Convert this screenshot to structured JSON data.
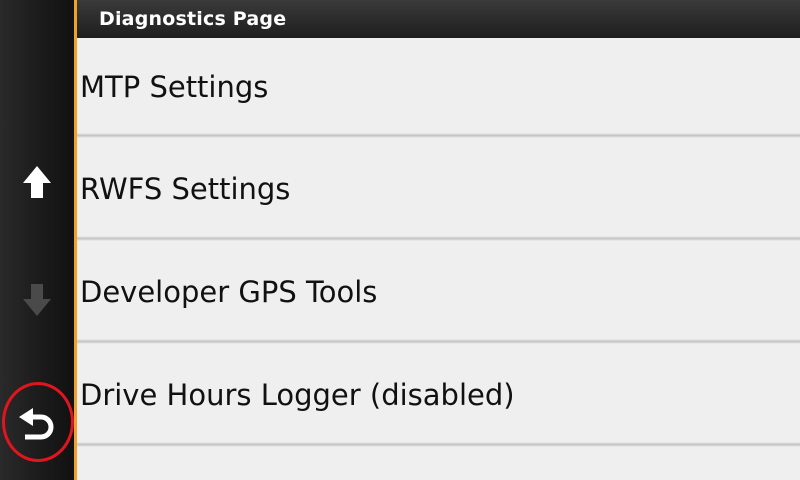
{
  "header": {
    "title": "Diagnostics Page"
  },
  "rail": {
    "up_icon": "arrow-up-icon",
    "down_icon": "arrow-down-icon",
    "back_icon": "back-arrow-icon",
    "up_enabled": true,
    "down_enabled": false,
    "accent_color": "#f0a030",
    "back_highlight_color": "#e0151e"
  },
  "menu": {
    "items": [
      {
        "label": "MTP Settings"
      },
      {
        "label": "RWFS Settings"
      },
      {
        "label": "Developer GPS Tools"
      },
      {
        "label": "Drive Hours Logger (disabled)"
      }
    ]
  }
}
